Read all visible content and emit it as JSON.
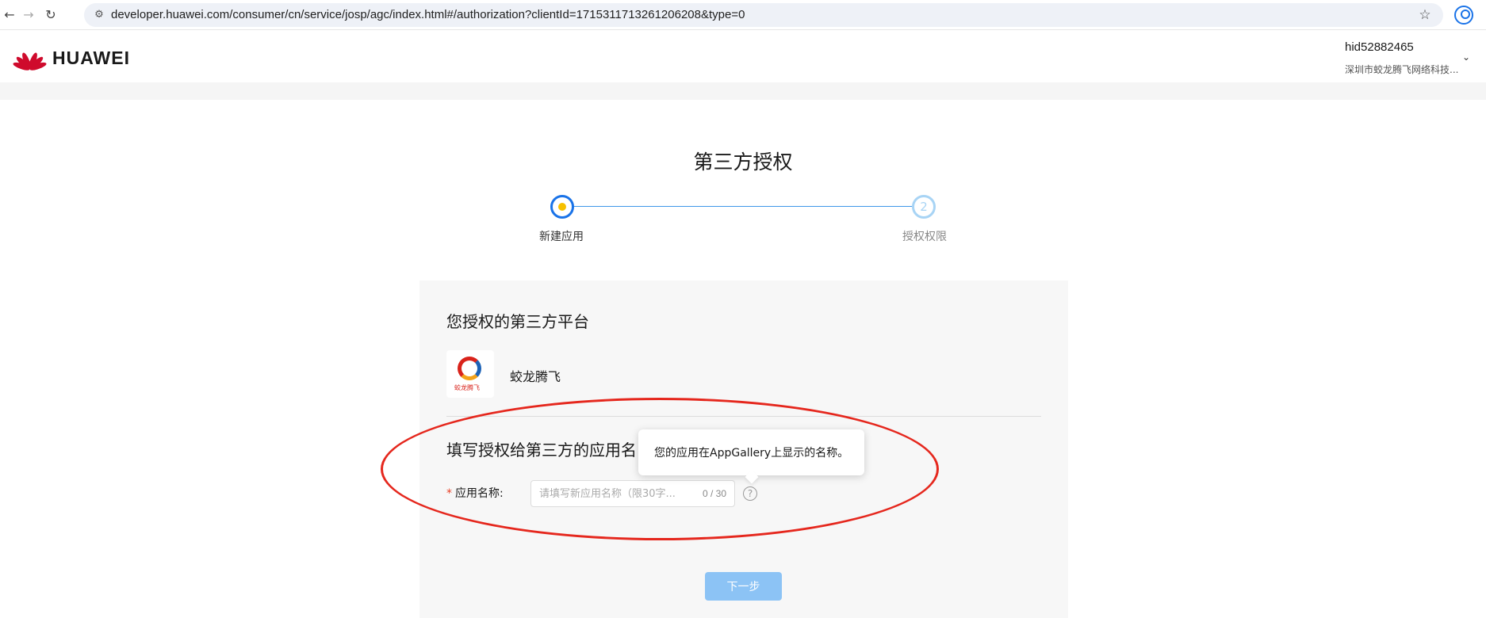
{
  "browser": {
    "url": "developer.huawei.com/consumer/cn/service/josp/agc/index.html#/authorization?clientId=1715311713261206208&type=0",
    "back_glyph": "←",
    "forward_glyph": "→",
    "reload_glyph": "↻",
    "site_info_glyph": "⚙",
    "bookmark_glyph": "☆"
  },
  "header": {
    "logo_text": "HUAWEI",
    "user_id": "hid52882465",
    "company": "深圳市蛟龙腾飞网络科技...",
    "chevron": "⌄",
    "brand_color": "#cf0a2c"
  },
  "page": {
    "title": "第三方授权"
  },
  "steps": {
    "step1_label": "新建应用",
    "step2_number": "2",
    "step2_label": "授权权限",
    "active_color": "#1a73e8"
  },
  "panel": {
    "section1_title": "您授权的第三方平台",
    "app_logo_text": "蛟龙腾飞",
    "app_name": "蛟龙腾飞",
    "section2_title": "填写授权给第三方的应用名",
    "required_mark": "*",
    "field_label": "应用名称:",
    "input_value": "",
    "input_placeholder": "请填写新应用名称（限30字...",
    "counter": "0 / 30",
    "help_glyph": "?"
  },
  "tooltip": {
    "text": "您的应用在AppGallery上显示的名称。"
  },
  "actions": {
    "next_label": "下一步"
  },
  "annotation": {
    "color": "#e5271d"
  }
}
